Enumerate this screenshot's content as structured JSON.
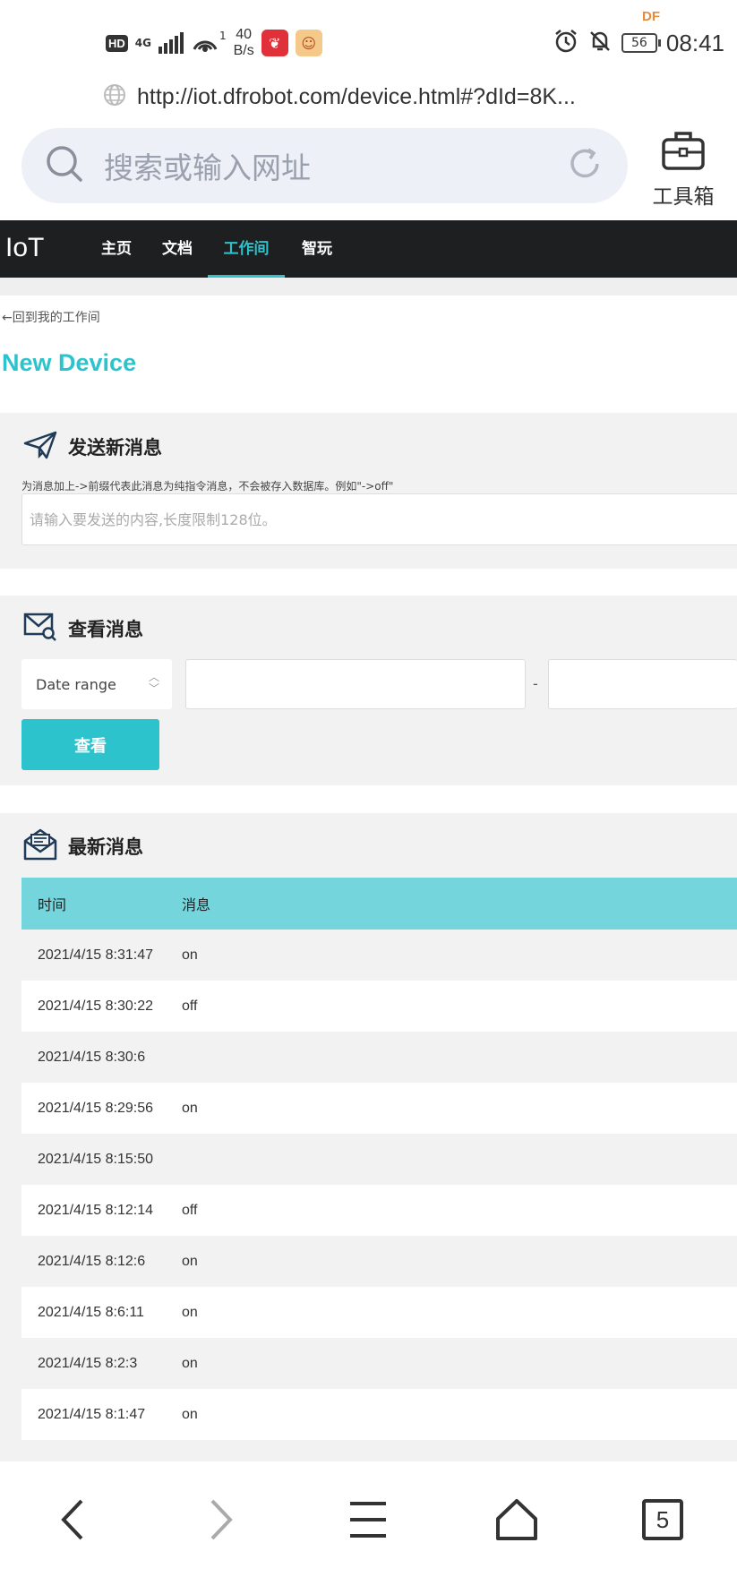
{
  "status_bar": {
    "hd": "HD",
    "network": "4G",
    "wifi_badge": "1",
    "speed_value": "40",
    "speed_unit": "B/s",
    "battery": "56",
    "time": "08:41",
    "watermark": "DF"
  },
  "browser": {
    "url": "http://iot.dfrobot.com/device.html#?dId=8K...",
    "search_placeholder": "搜索或输入网址",
    "toolbox_label": "工具箱",
    "tab_count": "5"
  },
  "site_nav": {
    "logo": "IoT",
    "items": [
      {
        "label": "主页",
        "active": false
      },
      {
        "label": "文档",
        "active": false
      },
      {
        "label": "工作间",
        "active": true
      },
      {
        "label": "智玩",
        "active": false
      }
    ]
  },
  "page": {
    "back_link": "←回到我的工作间",
    "device_title": "New Device"
  },
  "send_message": {
    "title": "发送新消息",
    "hint": "为消息加上->前缀代表此消息为纯指令消息，不会被存入数据库。例如\"->off\"",
    "input_placeholder": "请输入要发送的内容,长度限制128位。"
  },
  "view_messages": {
    "title": "查看消息",
    "select_value": "Date range",
    "start_value": "",
    "end_value": "",
    "separator": "-",
    "button_label": "查看"
  },
  "latest_messages": {
    "title": "最新消息",
    "headers": [
      "时间",
      "消息"
    ],
    "rows": [
      {
        "time": "2021/4/15 8:31:47",
        "message": "on"
      },
      {
        "time": "2021/4/15 8:30:22",
        "message": "off"
      },
      {
        "time": "2021/4/15 8:30:6",
        "message": ""
      },
      {
        "time": "2021/4/15 8:29:56",
        "message": "on"
      },
      {
        "time": "2021/4/15 8:15:50",
        "message": ""
      },
      {
        "time": "2021/4/15 8:12:14",
        "message": "off"
      },
      {
        "time": "2021/4/15 8:12:6",
        "message": "on"
      },
      {
        "time": "2021/4/15 8:6:11",
        "message": "on"
      },
      {
        "time": "2021/4/15 8:2:3",
        "message": "on"
      },
      {
        "time": "2021/4/15 8:1:47",
        "message": "on"
      }
    ]
  },
  "colors": {
    "accent": "#2dc3cc",
    "table_header": "#74d6dc",
    "nav_bg": "#1e1f21"
  }
}
